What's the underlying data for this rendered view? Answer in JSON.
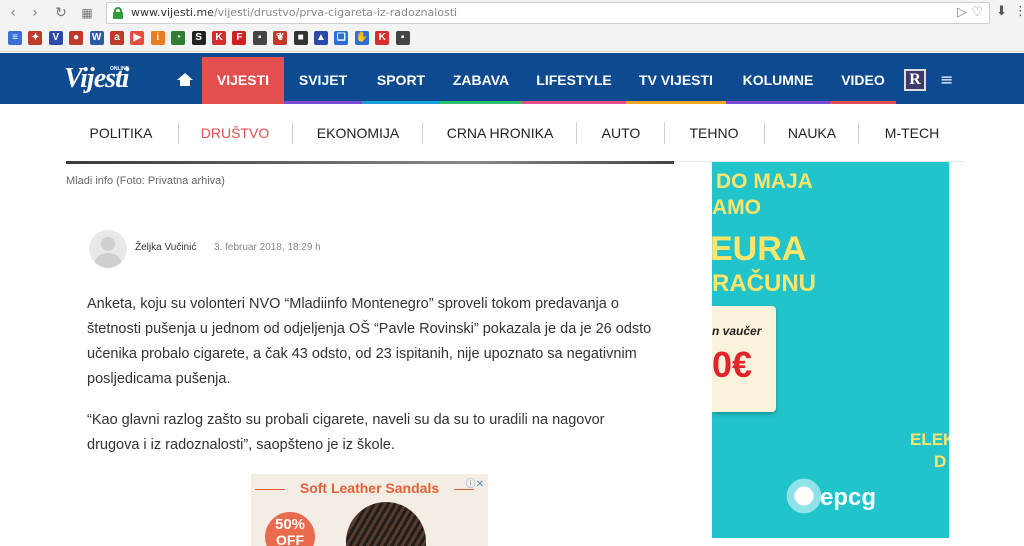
{
  "browser": {
    "url_domain": "www.vijesti.me",
    "url_path": "/vijesti/drustvo/prva-cigareta-iz-radoznalosti",
    "bookmarks": [
      {
        "icon": "bookmark-doc-icon",
        "color": "#3b6fd4",
        "glyph": "≡"
      },
      {
        "icon": "bookmark-bird-icon",
        "color": "#c0392b",
        "glyph": "✦"
      },
      {
        "icon": "bookmark-v-icon",
        "color": "#2d4aa8",
        "glyph": "V"
      },
      {
        "icon": "bookmark-cloud-icon",
        "color": "#c0392b",
        "glyph": "●"
      },
      {
        "icon": "bookmark-w-icon",
        "color": "#2b5aa8",
        "glyph": "W"
      },
      {
        "icon": "bookmark-a-icon",
        "color": "#c0392b",
        "glyph": "a"
      },
      {
        "icon": "bookmark-video-icon",
        "color": "#e74c3c",
        "glyph": "▶"
      },
      {
        "icon": "bookmark-i-icon",
        "color": "#e67e22",
        "glyph": "i"
      },
      {
        "icon": "bookmark-clock-icon",
        "color": "#2e7d32",
        "glyph": "◔"
      },
      {
        "icon": "bookmark-s-icon",
        "color": "#222222",
        "glyph": "S"
      },
      {
        "icon": "bookmark-k-icon",
        "color": "#d62d2d",
        "glyph": "K"
      },
      {
        "icon": "bookmark-f-icon",
        "color": "#cc2222",
        "glyph": "F"
      },
      {
        "icon": "bookmark-page-icon",
        "color": "#444444",
        "glyph": "▪"
      },
      {
        "icon": "bookmark-leaf-icon",
        "color": "#c0392b",
        "glyph": "❦"
      },
      {
        "icon": "bookmark-bag-icon",
        "color": "#333333",
        "glyph": "■"
      },
      {
        "icon": "bookmark-cap-icon",
        "color": "#2b4aa8",
        "glyph": "▲"
      },
      {
        "icon": "bookmark-book-icon",
        "color": "#2b6fd4",
        "glyph": "❑"
      },
      {
        "icon": "bookmark-hand-icon",
        "color": "#2b6fd4",
        "glyph": "✋"
      },
      {
        "icon": "bookmark-k2-icon",
        "color": "#d62d2d",
        "glyph": "K"
      },
      {
        "icon": "bookmark-page2-icon",
        "color": "#444444",
        "glyph": "▪"
      }
    ]
  },
  "site": {
    "logo": "Vijesti",
    "logo_tag": "ONLINE",
    "menu": [
      {
        "label": "VIJESTI",
        "active": true,
        "bar": ""
      },
      {
        "label": "SVIJET",
        "active": false,
        "bar": "#7b4bd1"
      },
      {
        "label": "SPORT",
        "active": false,
        "bar": "#1aa0d8"
      },
      {
        "label": "ZABAVA",
        "active": false,
        "bar": "#2bbf6a"
      },
      {
        "label": "LIFESTYLE",
        "active": false,
        "bar": "#e84e8a"
      },
      {
        "label": "TV VIJESTI",
        "active": false,
        "bar": "#f2a623"
      },
      {
        "label": "KOLUMNE",
        "active": false,
        "bar": "#7b4bd1"
      },
      {
        "label": "VIDEO",
        "active": false,
        "bar": "#e34e4e"
      }
    ],
    "r_badge": "R",
    "subnav": [
      "POLITIKA",
      "DRUŠTVO",
      "EKONOMIJA",
      "CRNA HRONIKA",
      "AUTO",
      "TEHNO",
      "NAUKA",
      "M-TECH"
    ],
    "subnav_active": "DRUŠTVO"
  },
  "article": {
    "caption": "Mladi info (Foto: Privatna arhiva)",
    "author": "Željka Vučinić",
    "date": "3. februar 2018, 18:29 h",
    "paragraphs": [
      "Anketa, koju su volonteri NVO “Mladiinfo Montenegro” sproveli tokom predavanja o štetnosti pušenja u jednom od odjeljenja OŠ “Pavle Rovinski” pokazala je da je 26 odsto učenika probalo cigarete, a čak 43 odsto, od 23 ispitanih, nije upoznato sa negativnim posljedicama pušenja.",
      "“Kao glavni razlog zašto su probali cigarete, naveli su da su to uradili na nagovor drugova i iz radoznalosti”, saopšteno je iz škole."
    ]
  },
  "ads": {
    "inline": {
      "title": "Soft Leather Sandals",
      "badge_pct": "50%",
      "badge_off": "OFF"
    },
    "side": {
      "line1": "DO MAJA",
      "line2": "AMO",
      "line3": "EURA",
      "line4": "RAČUNU",
      "voucher_label": "n vaučer",
      "voucher_value": "0€",
      "line5": "ELEKT",
      "line6": "D",
      "brand": "epcg"
    }
  },
  "colors": {
    "brand_blue": "#0d4a8f",
    "accent_red": "#e34e4e",
    "ad_teal": "#22c4cc"
  }
}
